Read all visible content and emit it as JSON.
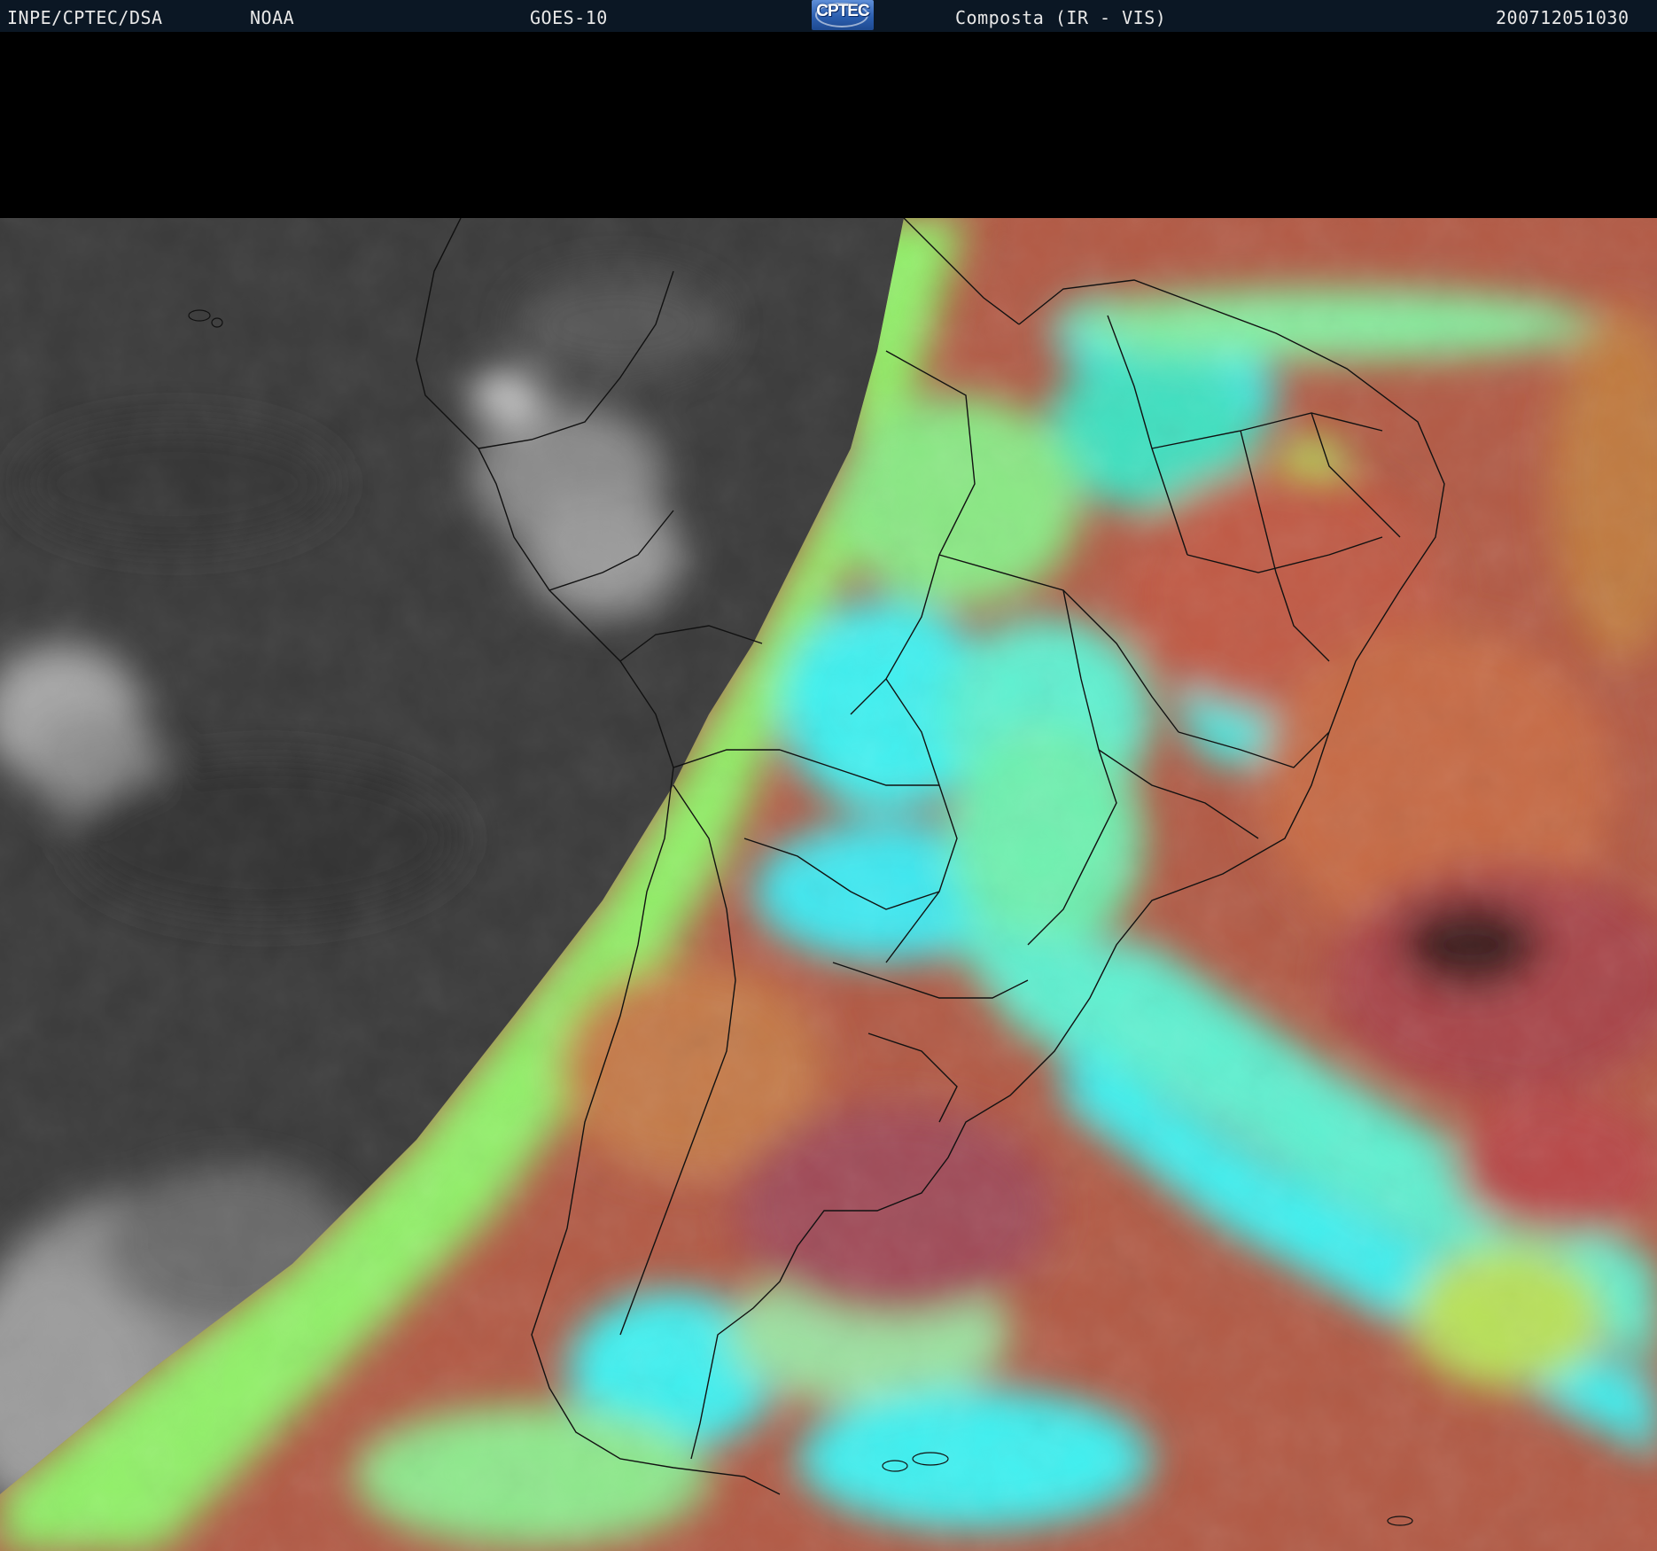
{
  "header": {
    "org": "INPE/CPTEC/DSA",
    "agency": "NOAA",
    "satellite": "GOES-10",
    "logo_text": "CPTEC",
    "product": "Composta (IR - VIS)",
    "timestamp": "200712051030"
  },
  "colors": {
    "header_bg": "#0b1724",
    "night_ir_gray": "#3a3a3a",
    "day_green": "#8ef070",
    "day_cyan": "#3ff0f0",
    "day_red": "#b04a45",
    "day_orange": "#c46a40",
    "border_lines": "#111111"
  },
  "map": {
    "region": "South America",
    "projection_note_visible": false
  }
}
